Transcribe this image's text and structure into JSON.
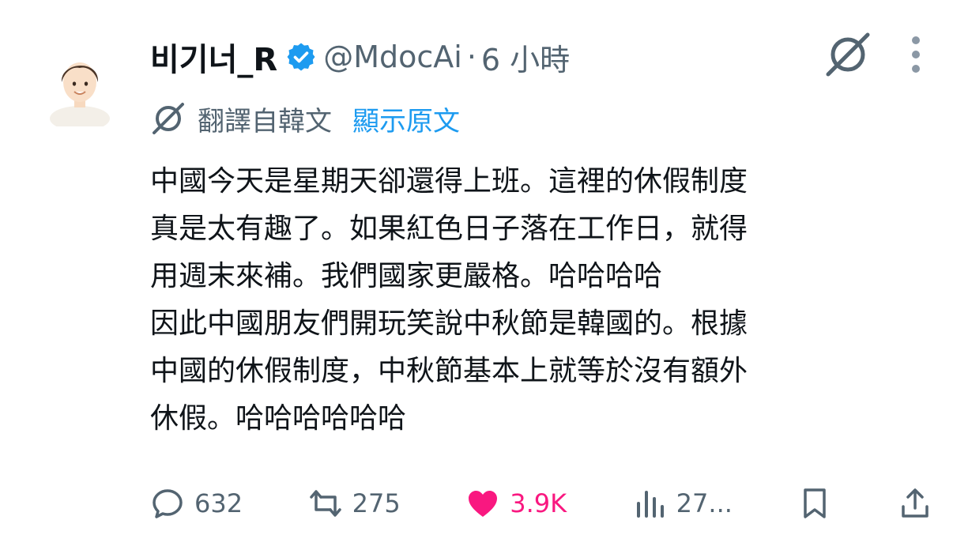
{
  "author": {
    "display_name": "비기너_R",
    "handle": "@MdocAi",
    "separator": "·",
    "time": "6 小時",
    "verified": true
  },
  "translation": {
    "translated_from": "翻譯自韓文",
    "show_original": "顯示原文"
  },
  "tweet": {
    "lines": [
      "中國今天是星期天卻還得上班。這裡的休假制度",
      "真是太有趣了。如果紅色日子落在工作日，就得",
      "用週末來補。我們國家更嚴格。哈哈哈哈",
      "因此中國朋友們開玩笑說中秋節是韓國的。根據",
      "中國的休假制度，中秋節基本上就等於沒有額外",
      "休假。哈哈哈哈哈哈"
    ]
  },
  "actions": {
    "replies": "632",
    "reposts": "275",
    "likes": "3.9K",
    "views": "27..."
  },
  "colors": {
    "text": "#0f1419",
    "muted": "#536471",
    "link": "#1d9bf0",
    "like": "#f91880",
    "verified": "#1d9bf0"
  },
  "icons": {
    "grok": "grok-icon",
    "more": "more-icon",
    "reply": "reply-icon",
    "repost": "repost-icon",
    "like": "heart-icon",
    "views": "views-icon",
    "bookmark": "bookmark-icon",
    "share": "share-icon"
  }
}
